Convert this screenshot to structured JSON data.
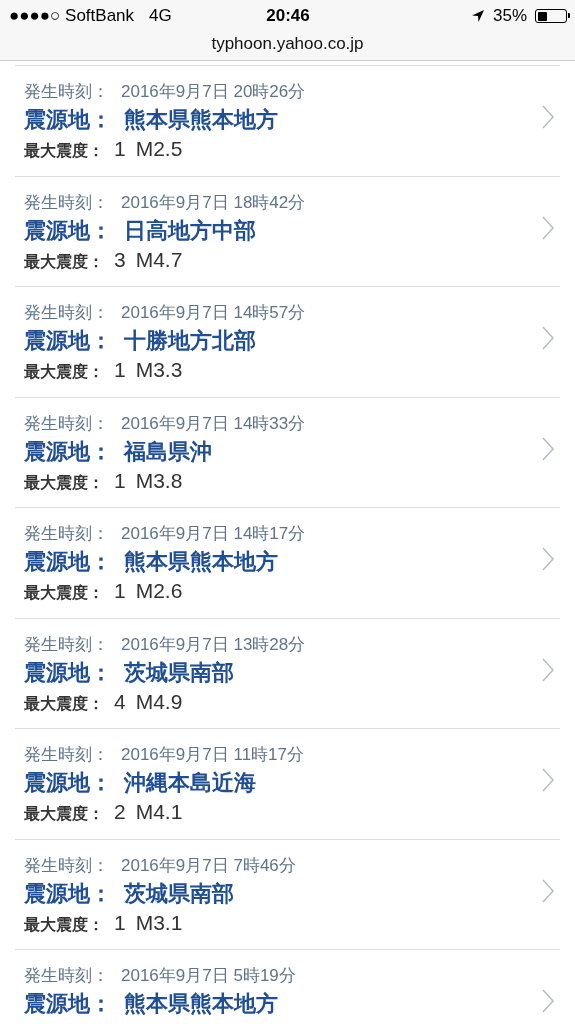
{
  "status_bar": {
    "carrier": "●●●●○ SoftBank",
    "network": "4G",
    "time": "20:46",
    "battery_percent": "35%"
  },
  "address_bar": {
    "url": "typhoon.yahoo.co.jp"
  },
  "earthquakes": [
    {
      "time_label": "発生時刻：",
      "time": "2016年9月7日 20時26分",
      "epicenter_label": "震源地：",
      "epicenter": "熊本県熊本地方",
      "intensity_label": "最大震度：",
      "intensity": "1",
      "magnitude": "M2.5"
    },
    {
      "time_label": "発生時刻：",
      "time": "2016年9月7日 18時42分",
      "epicenter_label": "震源地：",
      "epicenter": "日高地方中部",
      "intensity_label": "最大震度：",
      "intensity": "3",
      "magnitude": "M4.7"
    },
    {
      "time_label": "発生時刻：",
      "time": "2016年9月7日 14時57分",
      "epicenter_label": "震源地：",
      "epicenter": "十勝地方北部",
      "intensity_label": "最大震度：",
      "intensity": "1",
      "magnitude": "M3.3"
    },
    {
      "time_label": "発生時刻：",
      "time": "2016年9月7日 14時33分",
      "epicenter_label": "震源地：",
      "epicenter": "福島県沖",
      "intensity_label": "最大震度：",
      "intensity": "1",
      "magnitude": "M3.8"
    },
    {
      "time_label": "発生時刻：",
      "time": "2016年9月7日 14時17分",
      "epicenter_label": "震源地：",
      "epicenter": "熊本県熊本地方",
      "intensity_label": "最大震度：",
      "intensity": "1",
      "magnitude": "M2.6"
    },
    {
      "time_label": "発生時刻：",
      "time": "2016年9月7日 13時28分",
      "epicenter_label": "震源地：",
      "epicenter": "茨城県南部",
      "intensity_label": "最大震度：",
      "intensity": "4",
      "magnitude": "M4.9"
    },
    {
      "time_label": "発生時刻：",
      "time": "2016年9月7日 11時17分",
      "epicenter_label": "震源地：",
      "epicenter": "沖縄本島近海",
      "intensity_label": "最大震度：",
      "intensity": "2",
      "magnitude": "M4.1"
    },
    {
      "time_label": "発生時刻：",
      "time": "2016年9月7日 7時46分",
      "epicenter_label": "震源地：",
      "epicenter": "茨城県南部",
      "intensity_label": "最大震度：",
      "intensity": "1",
      "magnitude": "M3.1"
    },
    {
      "time_label": "発生時刻：",
      "time": "2016年9月7日 5時19分",
      "epicenter_label": "震源地：",
      "epicenter": "熊本県熊本地方"
    }
  ]
}
